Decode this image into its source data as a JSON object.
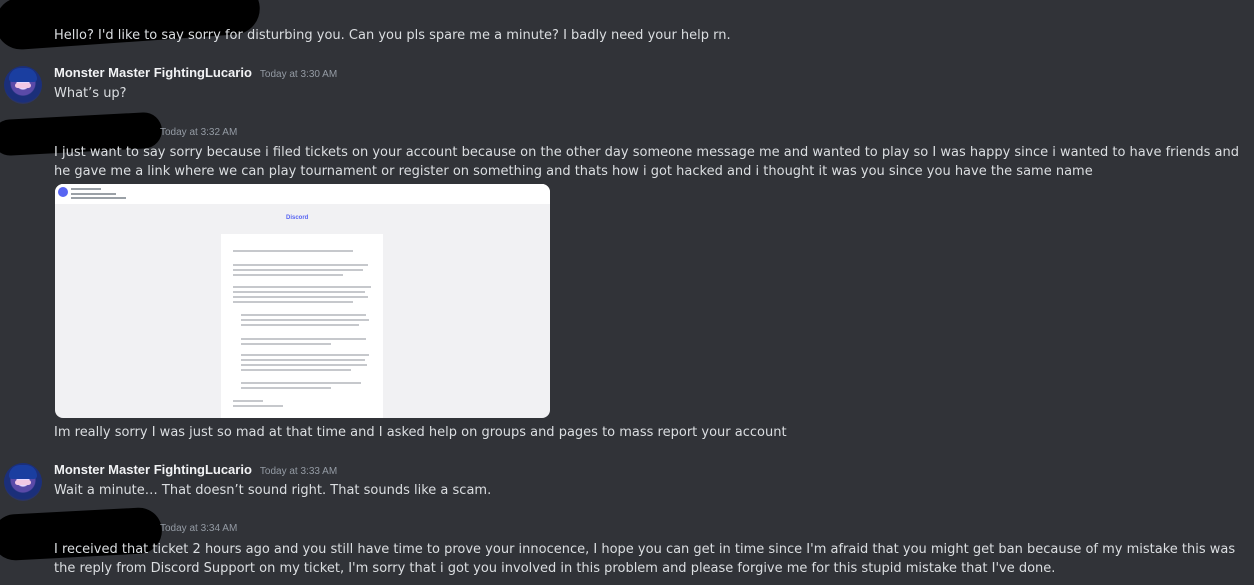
{
  "messages": [
    {
      "text": "Hello? I'd like to say sorry for disturbing you. Can you pls spare me a minute? I badly need your help rn."
    },
    {
      "author": "Monster Master FightingLucario",
      "time": "Today at 3:30 AM",
      "text": "What’s up?"
    },
    {
      "time": "Today at 3:32 AM",
      "text": "I just want to say sorry because i filed tickets on your account because on the other day someone message me and wanted to play so I was happy since i wanted to have friends and he gave me a link where we can play tournament or register on something and thats how i got hacked and i thought it was you since you have the same name"
    },
    {
      "text": "Im really sorry I was just so mad at that time and I asked help on groups and pages to mass report your account"
    },
    {
      "author": "Monster Master FightingLucario",
      "time": "Today at 3:33 AM",
      "text": "Wait a minute… That doesn’t sound right. That sounds like a scam."
    },
    {
      "time": "Today at 3:34 AM",
      "text": "I received that ticket 2 hours ago and you still have time to prove your innocence, I hope you can get in time since I'm afraid that you might get ban because of my mistake this was the reply from Discord Support on my ticket, I'm sorry that i got you involved in this problem and please forgive me for this stupid mistake that I've done."
    }
  ],
  "attachment": {
    "brand": "Discord"
  },
  "colors": {
    "background": "#313338",
    "text": "#dbdee1",
    "username": "#f2f3f5",
    "timestamp": "#949ba4",
    "blurple": "#5865f2"
  }
}
